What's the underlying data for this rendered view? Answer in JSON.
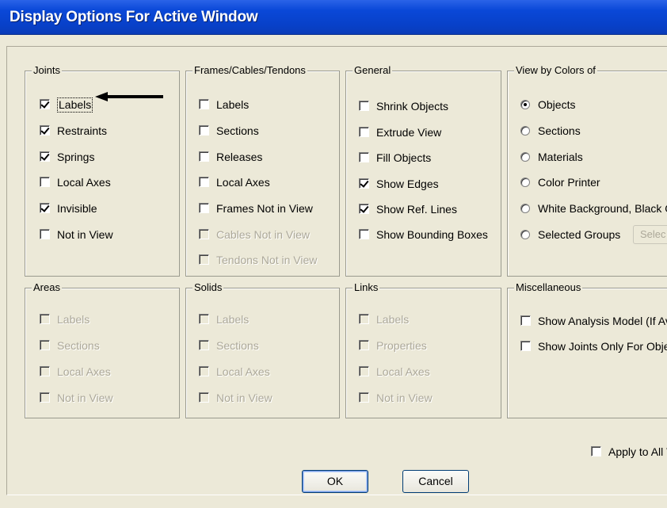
{
  "window": {
    "title": "Display Options For Active Window"
  },
  "joints": {
    "title": "Joints",
    "items": [
      {
        "label": "Labels",
        "checked": true
      },
      {
        "label": "Restraints",
        "checked": true
      },
      {
        "label": "Springs",
        "checked": true
      },
      {
        "label": "Local Axes",
        "checked": false
      },
      {
        "label": "Invisible",
        "checked": true
      },
      {
        "label": "Not in View",
        "checked": false
      }
    ]
  },
  "frames": {
    "title": "Frames/Cables/Tendons",
    "items": [
      {
        "label": "Labels",
        "checked": false,
        "enabled": true
      },
      {
        "label": "Sections",
        "checked": false,
        "enabled": true
      },
      {
        "label": "Releases",
        "checked": false,
        "enabled": true
      },
      {
        "label": "Local Axes",
        "checked": false,
        "enabled": true
      },
      {
        "label": "Frames Not in View",
        "checked": false,
        "enabled": true
      },
      {
        "label": "Cables Not in View",
        "checked": false,
        "enabled": false
      },
      {
        "label": "Tendons Not in View",
        "checked": false,
        "enabled": false
      }
    ]
  },
  "general": {
    "title": "General",
    "items": [
      {
        "label": "Shrink Objects",
        "checked": false
      },
      {
        "label": "Extrude View",
        "checked": false
      },
      {
        "label": "Fill Objects",
        "checked": false
      },
      {
        "label": "Show Edges",
        "checked": true
      },
      {
        "label": "Show Ref. Lines",
        "checked": true
      },
      {
        "label": "Show Bounding Boxes",
        "checked": false
      }
    ]
  },
  "view_colors": {
    "title": "View by Colors of",
    "options": [
      {
        "label": "Objects",
        "selected": true
      },
      {
        "label": "Sections",
        "selected": false
      },
      {
        "label": "Materials",
        "selected": false
      },
      {
        "label": "Color Printer",
        "selected": false
      },
      {
        "label": "White Background, Black Ol",
        "selected": false
      },
      {
        "label": "Selected Groups",
        "selected": false
      }
    ],
    "select_button": "Selec"
  },
  "areas": {
    "title": "Areas",
    "items": [
      {
        "label": "Labels"
      },
      {
        "label": "Sections"
      },
      {
        "label": "Local Axes"
      },
      {
        "label": "Not in View"
      }
    ]
  },
  "solids": {
    "title": "Solids",
    "items": [
      {
        "label": "Labels"
      },
      {
        "label": "Sections"
      },
      {
        "label": "Local Axes"
      },
      {
        "label": "Not in View"
      }
    ]
  },
  "links": {
    "title": "Links",
    "items": [
      {
        "label": "Labels"
      },
      {
        "label": "Properties"
      },
      {
        "label": "Local Axes"
      },
      {
        "label": "Not in View"
      }
    ]
  },
  "misc": {
    "title": "Miscellaneous",
    "items": [
      {
        "label": "Show Analysis Model  (If Ava",
        "checked": false
      },
      {
        "label": "Show Joints Only For Objects",
        "checked": false
      }
    ]
  },
  "apply_all": {
    "label": "Apply to All V",
    "checked": false
  },
  "buttons": {
    "ok": "OK",
    "cancel": "Cancel"
  }
}
